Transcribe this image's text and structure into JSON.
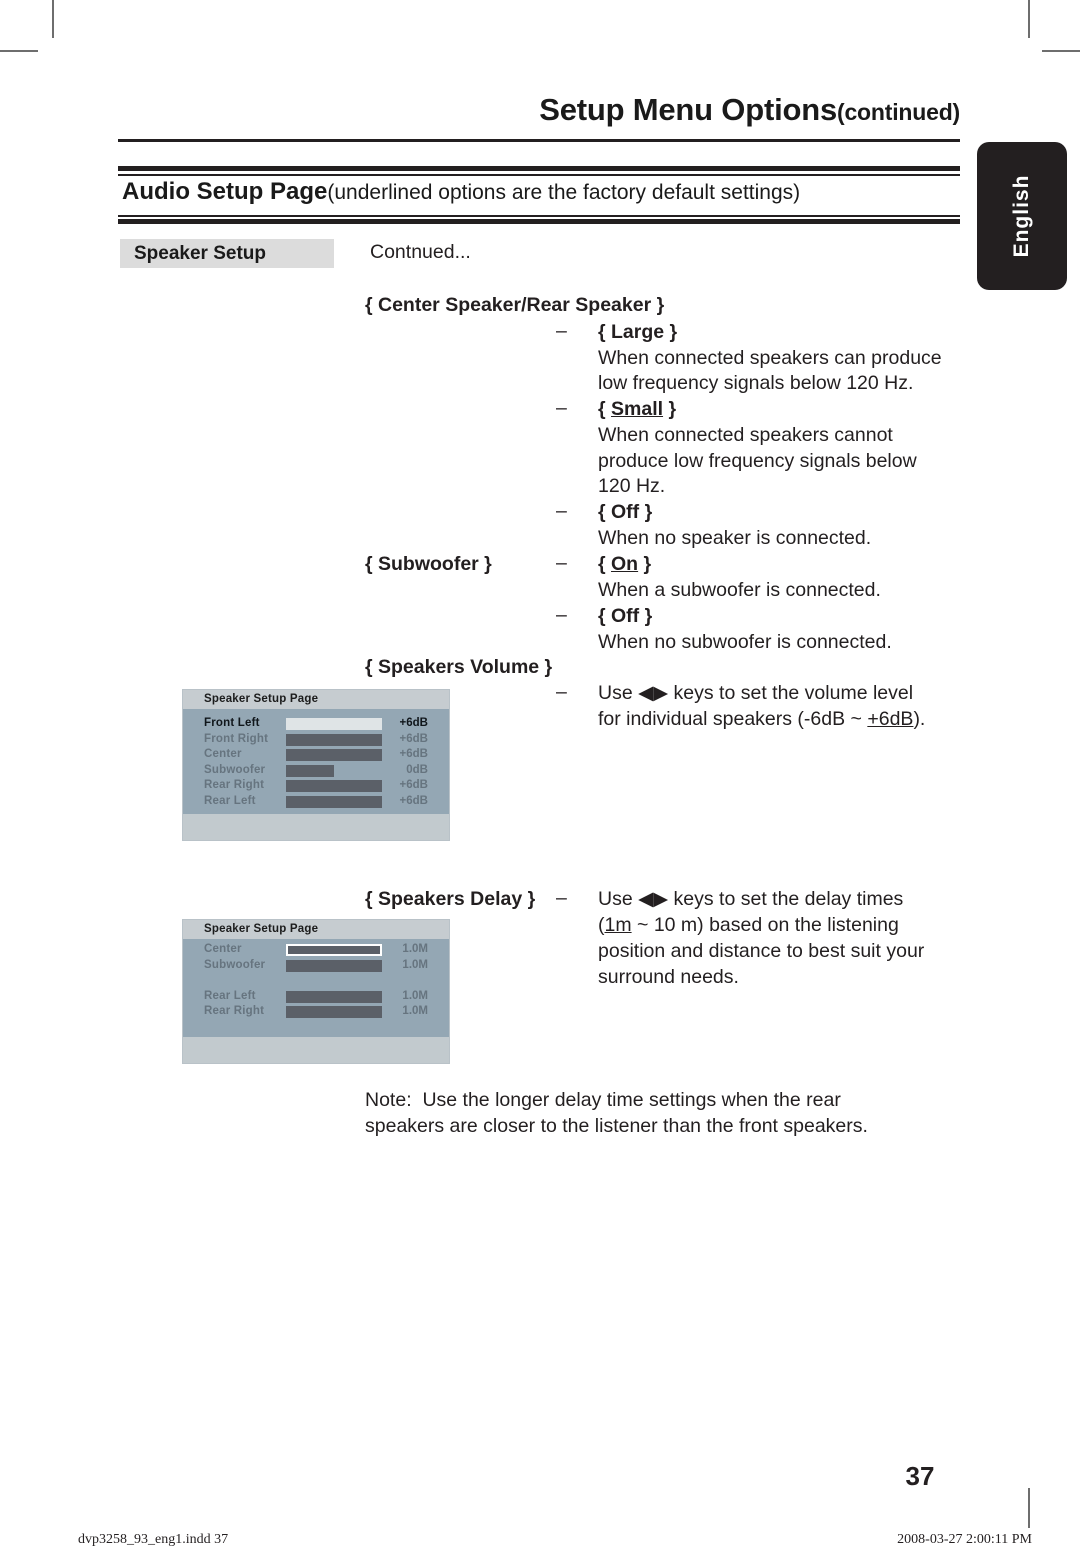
{
  "header": {
    "title_main": "Setup Menu Options",
    "title_suffix": "(continued)",
    "section_title_bold": "Audio Setup Page",
    "section_title_rest": "(underlined options are the factory default settings)",
    "language_tab": "English"
  },
  "sidebar": {
    "label": "Speaker Setup"
  },
  "body": {
    "continued_note": "Contnued...",
    "center_rear_heading": "{ Center Speaker/Rear Speaker }",
    "opt_large": "{ Large }",
    "opt_large_desc_l1": "When connected speakers can produce",
    "opt_large_desc_l2": "low frequency signals below 120 Hz.",
    "opt_small_pre": "{ ",
    "opt_small": "Small",
    "opt_small_post": " }",
    "opt_small_desc_l1": "When connected speakers cannot",
    "opt_small_desc_l2": "produce low frequency signals below",
    "opt_small_desc_l3": "120 Hz.",
    "opt_off1": "{ Off }",
    "opt_off1_desc": "When no speaker is connected.",
    "subwoofer_heading": "{ Subwoofer }",
    "opt_on_pre": "{ ",
    "opt_on": "On",
    "opt_on_post": " }",
    "opt_on_desc": "When a subwoofer is connected.",
    "opt_off2": "{ Off }",
    "opt_off2_desc": "When no subwoofer is connected.",
    "speakers_volume_heading": "{ Speakers Volume }",
    "volume_desc_l1_a": "Use ",
    "volume_desc_l1_arrows": "◀▶",
    "volume_desc_l1_b": " keys to set the volume level",
    "volume_desc_l2_a": "for individual speakers (-6dB ~ ",
    "volume_desc_l2_u": "+6dB",
    "volume_desc_l2_b": ").",
    "speakers_delay_heading": "{ Speakers Delay }",
    "delay_desc_l1_a": "Use ",
    "delay_desc_l1_arrows": "◀▶",
    "delay_desc_l1_b": " keys to set the delay times",
    "delay_desc_l2_a": "(",
    "delay_desc_l2_u": "1m",
    "delay_desc_l2_b": " ~ 10 m) based on the listening",
    "delay_desc_l3": "position and distance to best suit your",
    "delay_desc_l4": "surround needs.",
    "dash": "–",
    "note_label": "Note:",
    "note_l1": "Use the longer delay time settings when the rear",
    "note_l2": "speakers are closer to the listener than the front speakers."
  },
  "osd_volume": {
    "title": "Speaker Setup Page",
    "rows": [
      {
        "name": "Front Left",
        "value": "+6dB",
        "fill_pct": 100,
        "state": "selected"
      },
      {
        "name": "Front Right",
        "value": "+6dB",
        "fill_pct": 100,
        "state": "normal"
      },
      {
        "name": "Center",
        "value": "+6dB",
        "fill_pct": 100,
        "state": "normal"
      },
      {
        "name": "Subwoofer",
        "value": "0dB",
        "fill_pct": 50,
        "state": "normal"
      },
      {
        "name": "Rear Right",
        "value": "+6dB",
        "fill_pct": 100,
        "state": "normal"
      },
      {
        "name": "Rear Left",
        "value": "+6dB",
        "fill_pct": 100,
        "state": "normal"
      }
    ]
  },
  "osd_delay": {
    "title": "Speaker Setup Page",
    "rows": [
      {
        "name": "Center",
        "value": "1.0M",
        "fill_pct": 100,
        "state": "outline"
      },
      {
        "name": "Subwoofer",
        "value": "1.0M",
        "fill_pct": 100,
        "state": "normal"
      },
      {
        "name": "",
        "value": "",
        "fill_pct": 0,
        "state": "blank"
      },
      {
        "name": "Rear Left",
        "value": "1.0M",
        "fill_pct": 100,
        "state": "normal"
      },
      {
        "name": "Rear Right",
        "value": "1.0M",
        "fill_pct": 100,
        "state": "normal"
      }
    ]
  },
  "footer": {
    "page_number": "37",
    "file_info": "dvp3258_93_eng1.indd   37",
    "timestamp": "2008-03-27   2:00:11 PM"
  },
  "colors": {
    "ink": "#231f20",
    "label_box_bg": "#dcdcdc",
    "tab_bg": "#231f20",
    "osd_body": "#94a7b4",
    "osd_header": "#c6ccd0",
    "osd_footer": "#c2cace",
    "osd_bar": "#5b6068",
    "osd_bar_selected": "#dfe4e6"
  }
}
